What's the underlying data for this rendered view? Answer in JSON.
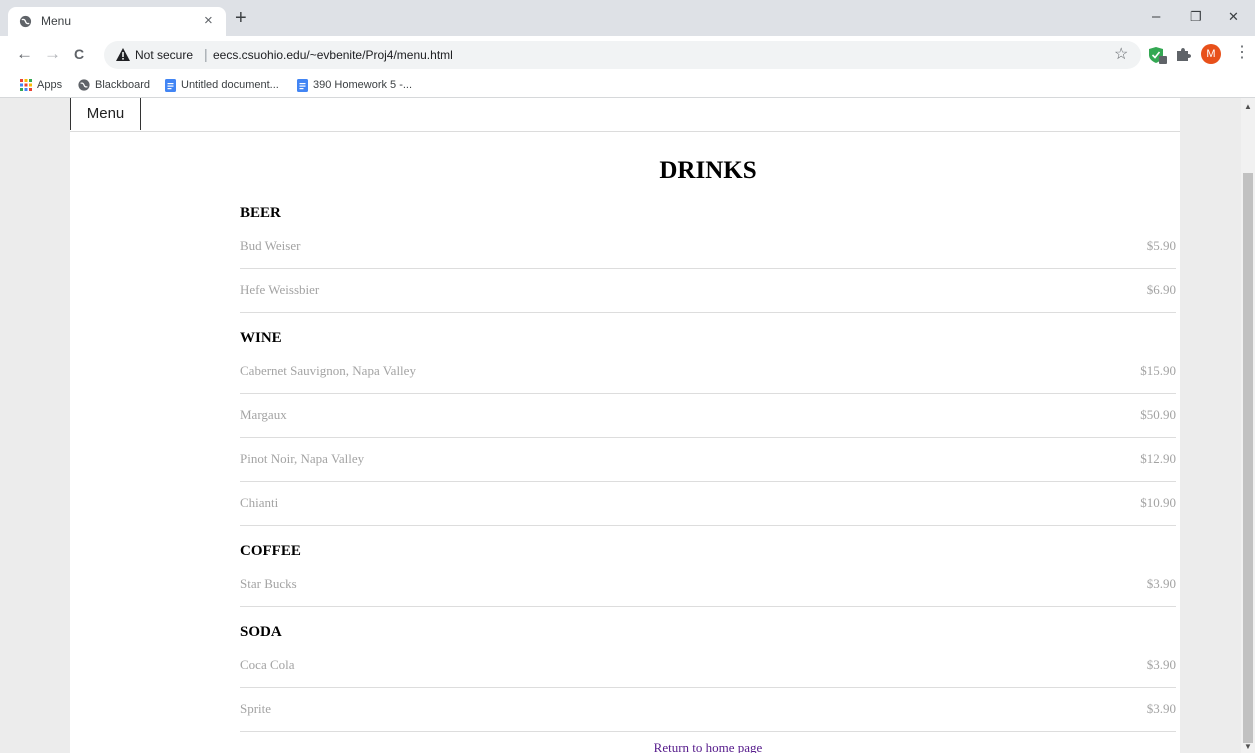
{
  "browser": {
    "tab_title": "Menu",
    "tab_close": "×",
    "new_tab": "+",
    "window_controls": {
      "minimize": "–",
      "restore": "❐",
      "close": "✕"
    },
    "nav": {
      "back": "←",
      "forward": "→",
      "reload": "C"
    },
    "security_label": "Not secure",
    "url_separator": "|",
    "url": "eecs.csuohio.edu/~evbenite/Proj4/menu.html",
    "bookmark_star": "☆",
    "profile_initial": "M",
    "menu_glyph": "⋮",
    "bookmarks": [
      {
        "label": "Apps",
        "icon": "apps-grid-icon"
      },
      {
        "label": "Blackboard",
        "icon": "globe-icon"
      },
      {
        "label": "Untitled document...",
        "icon": "docs-icon"
      },
      {
        "label": "390 Homework 5 -...",
        "icon": "docs-icon"
      }
    ]
  },
  "page": {
    "nav_link": "Menu",
    "title": "DRINKS",
    "sections": [
      {
        "title": "BEER",
        "items": [
          {
            "name": "Bud Weiser",
            "price": "$5.90"
          },
          {
            "name": "Hefe Weissbier",
            "price": "$6.90"
          }
        ]
      },
      {
        "title": "WINE",
        "items": [
          {
            "name": "Cabernet Sauvignon, Napa Valley",
            "price": "$15.90"
          },
          {
            "name": "Margaux",
            "price": "$50.90"
          },
          {
            "name": "Pinot Noir, Napa Valley",
            "price": "$12.90"
          },
          {
            "name": "Chianti",
            "price": "$10.90"
          }
        ]
      },
      {
        "title": "COFFEE",
        "items": [
          {
            "name": "Star Bucks",
            "price": "$3.90"
          }
        ]
      },
      {
        "title": "SODA",
        "items": [
          {
            "name": "Coca Cola",
            "price": "$3.90"
          },
          {
            "name": "Sprite",
            "price": "$3.90"
          }
        ]
      }
    ],
    "home_link": "Return to home page"
  },
  "colors": {
    "item_text": "#a3a3a3",
    "visited_link": "#551a8b",
    "tabstrip": "#dee1e6",
    "avatar": "#e8501a"
  }
}
